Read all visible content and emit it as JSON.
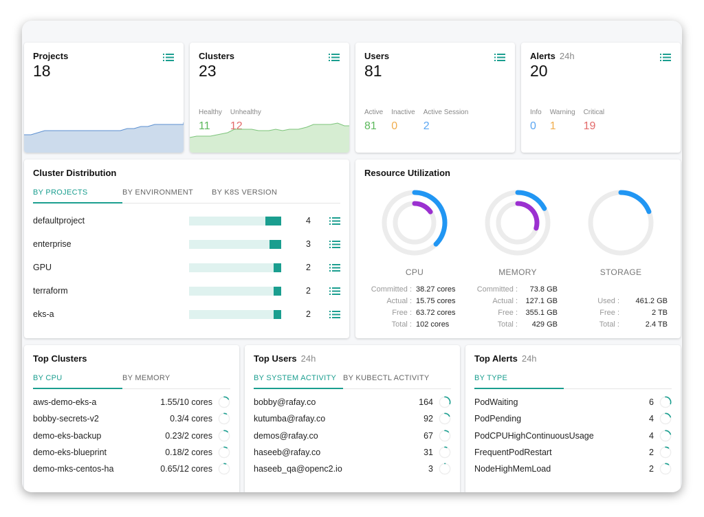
{
  "summary": [
    {
      "title": "Projects",
      "count": "18",
      "stats": []
    },
    {
      "title": "Clusters",
      "count": "23",
      "stats": [
        {
          "label": "Healthy",
          "value": "11",
          "color": "#5cb85c"
        },
        {
          "label": "Unhealthy",
          "value": "12",
          "color": "#e36a6a"
        }
      ]
    },
    {
      "title": "Users",
      "count": "81",
      "stats": [
        {
          "label": "Active",
          "value": "81",
          "color": "#5cb85c"
        },
        {
          "label": "Inactive",
          "value": "0",
          "color": "#f0ad4e"
        },
        {
          "label": "Active Session",
          "value": "2",
          "color": "#5aa6f2"
        }
      ]
    },
    {
      "title": "Alerts",
      "subtitle": "24h",
      "count": "20",
      "stats": [
        {
          "label": "Info",
          "value": "0",
          "color": "#5aa6f2"
        },
        {
          "label": "Warning",
          "value": "1",
          "color": "#f0ad4e"
        },
        {
          "label": "Critical",
          "value": "19",
          "color": "#e36a6a"
        }
      ]
    }
  ],
  "colors": {
    "accent": "#1a9e8f",
    "blue": "#2196f3",
    "purple": "#9b30d0",
    "projects_fill": "#ccdbec",
    "projects_line": "#5b8fd0",
    "clusters_fill": "#d6edd2",
    "clusters_line": "#7cc47a"
  },
  "distribution": {
    "title": "Cluster Distribution",
    "tabs": [
      "BY PROJECTS",
      "BY ENVIRONMENT",
      "BY K8S VERSION"
    ],
    "rows": [
      {
        "name": "defaultproject",
        "count": 4
      },
      {
        "name": "enterprise",
        "count": 3
      },
      {
        "name": "GPU",
        "count": 2
      },
      {
        "name": "terraform",
        "count": 2
      },
      {
        "name": "eks-a",
        "count": 2
      }
    ]
  },
  "resources": {
    "title": "Resource Utilization",
    "cpu": {
      "label": "CPU",
      "committed_pct": 37.5,
      "actual_pct": 15.4,
      "rows": [
        [
          "Committed :",
          "38.27 cores"
        ],
        [
          "Actual :",
          "15.75 cores"
        ],
        [
          "Free :",
          "63.72 cores"
        ],
        [
          "Total :",
          "102 cores"
        ]
      ]
    },
    "memory": {
      "label": "MEMORY",
      "committed_pct": 17.2,
      "actual_pct": 29.6,
      "rows": [
        [
          "Committed :",
          "73.8 GB"
        ],
        [
          "Actual :",
          "127.1 GB"
        ],
        [
          "Free :",
          "355.1 GB"
        ],
        [
          "Total :",
          "429 GB"
        ]
      ]
    },
    "storage": {
      "label": "STORAGE",
      "used_pct": 19,
      "rows": [
        [
          "Used :",
          "461.2 GB"
        ],
        [
          "Free :",
          "2 TB"
        ],
        [
          "Total :",
          "2.4 TB"
        ]
      ]
    }
  },
  "top_clusters": {
    "title": "Top Clusters",
    "tabs": [
      "BY CPU",
      "BY MEMORY"
    ],
    "rows": [
      {
        "name": "aws-demo-eks-a",
        "value": "1.55/10 cores",
        "pct": 15.5
      },
      {
        "name": "bobby-secrets-v2",
        "value": "0.3/4 cores",
        "pct": 7.5
      },
      {
        "name": "demo-eks-backup",
        "value": "0.23/2 cores",
        "pct": 11.5
      },
      {
        "name": "demo-eks-blueprint",
        "value": "0.18/2 cores",
        "pct": 9
      },
      {
        "name": "demo-mks-centos-ha",
        "value": "0.65/12 cores",
        "pct": 5.4
      }
    ]
  },
  "top_users": {
    "title": "Top Users",
    "subtitle": "24h",
    "tabs": [
      "BY SYSTEM ACTIVITY",
      "BY KUBECTL ACTIVITY"
    ],
    "rows": [
      {
        "name": "bobby@rafay.co",
        "value": "164",
        "pct": 30
      },
      {
        "name": "kutumba@rafay.co",
        "value": "92",
        "pct": 17
      },
      {
        "name": "demos@rafay.co",
        "value": "67",
        "pct": 12
      },
      {
        "name": "haseeb@rafay.co",
        "value": "31",
        "pct": 6
      },
      {
        "name": "haseeb_qa@openc2.io",
        "value": "3",
        "pct": 1
      }
    ]
  },
  "top_alerts": {
    "title": "Top Alerts",
    "subtitle": "24h",
    "tabs": [
      "BY TYPE"
    ],
    "rows": [
      {
        "name": "PodWaiting",
        "value": "6",
        "pct": 30
      },
      {
        "name": "PodPending",
        "value": "4",
        "pct": 20
      },
      {
        "name": "PodCPUHighContinuousUsage",
        "value": "4",
        "pct": 20
      },
      {
        "name": "FrequentPodRestart",
        "value": "2",
        "pct": 10
      },
      {
        "name": "NodeHighMemLoad",
        "value": "2",
        "pct": 10
      }
    ]
  }
}
